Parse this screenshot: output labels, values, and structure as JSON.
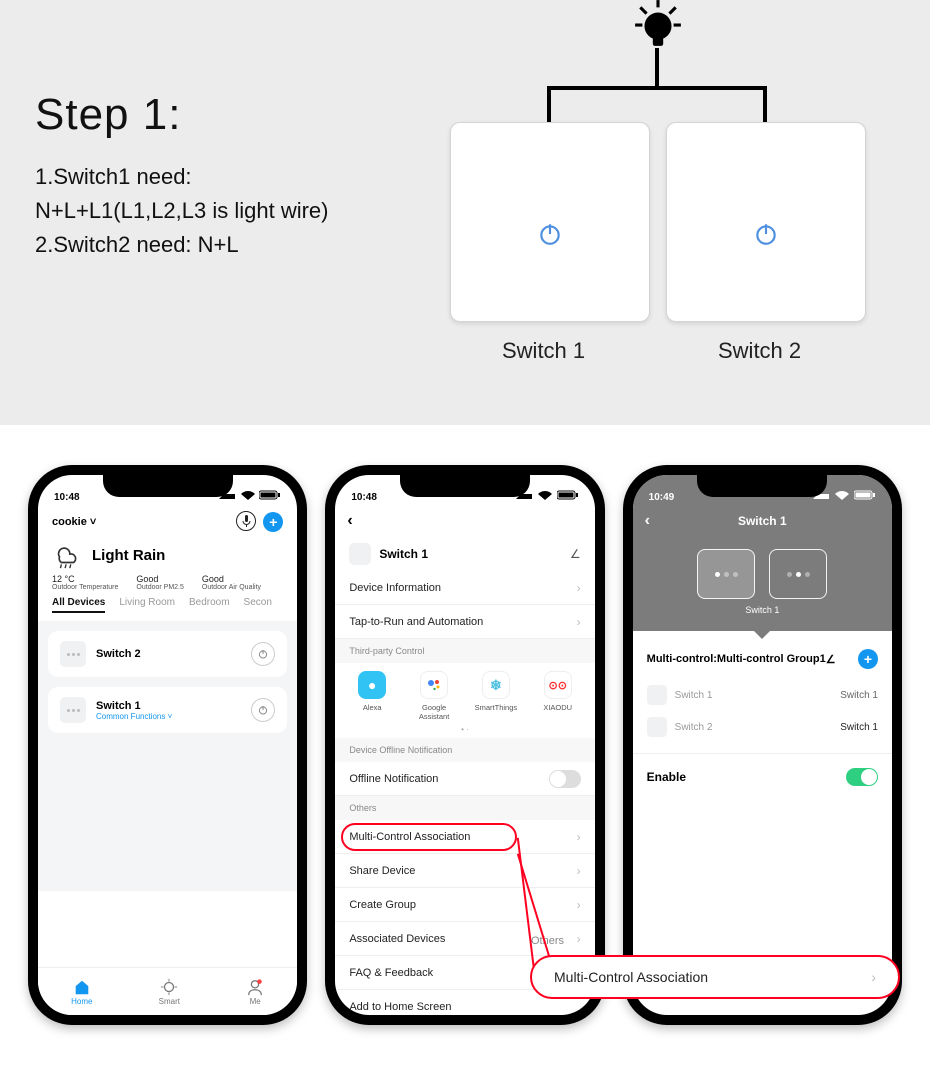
{
  "diagram": {
    "step_title": "Step 1:",
    "line1": "1.Switch1 need:",
    "line2": "N+L+L1(L1,L2,L3 is light wire)",
    "line3": "2.Switch2 need: N+L",
    "switch1_label": "Switch 1",
    "switch2_label": "Switch 2"
  },
  "phone1": {
    "time": "10:48",
    "home_label": "cookie",
    "weather_title": "Light Rain",
    "temp": "12 °C",
    "temp_sub": "Outdoor Temperature",
    "pm25": "Good",
    "pm25_sub": "Outdoor PM2.5",
    "aq": "Good",
    "aq_sub": "Outdoor Air Quality",
    "tabs": [
      "All Devices",
      "Living Room",
      "Bedroom",
      "Secon"
    ],
    "dev1": "Switch 2",
    "dev2": "Switch 1",
    "dev2_sub": "Common Functions",
    "tab_home": "Home",
    "tab_smart": "Smart",
    "tab_me": "Me"
  },
  "phone2": {
    "time": "10:48",
    "title": "Switch 1",
    "rows": {
      "info": "Device Information",
      "tap": "Tap-to-Run and Automation",
      "tpc_hdr": "Third-party Control",
      "alexa": "Alexa",
      "google": "Google Assistant",
      "smartthings": "SmartThings",
      "xiaodu": "XIAODU",
      "off_hdr": "Device Offline Notification",
      "offline": "Offline Notification",
      "others_hdr": "Others",
      "multi": "Multi-Control Association",
      "share": "Share Device",
      "group": "Create Group",
      "assoc": "Associated Devices",
      "faq": "FAQ & Feedback",
      "addhome": "Add to Home Screen"
    }
  },
  "phone3": {
    "time": "10:49",
    "title": "Switch 1",
    "tile_sub": "Switch 1",
    "mc_title": "Multi-control:Multi-control Group1",
    "rowA_l": "Switch 1",
    "rowA_r": "Switch 1",
    "rowB_l": "Switch 2",
    "rowB_r": "Switch 1",
    "enable": "Enable"
  },
  "callout": {
    "hdr": "Others",
    "text": "Multi-Control Association"
  }
}
